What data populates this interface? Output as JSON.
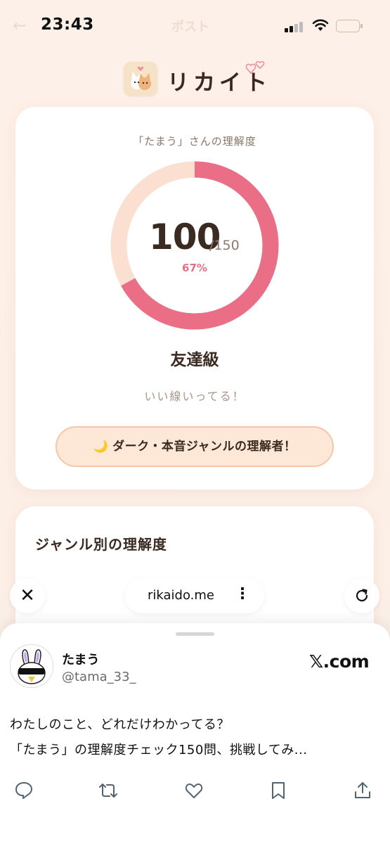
{
  "status": {
    "time": "23:43"
  },
  "ghost_header": {
    "back": "←",
    "title": "ポスト"
  },
  "app": {
    "name": "リカイト"
  },
  "result": {
    "caption": "「たまう」さんの理解度",
    "score": "100",
    "total": "/150",
    "percent_label": "67%",
    "progress": 0.67,
    "rank": "友達級",
    "comment": "いい線いってる！",
    "badge_icon": "🌙",
    "badge_label": "ダーク・本音ジャンルの理解者！"
  },
  "genre": {
    "title": "ジャンル別の理解度"
  },
  "browser": {
    "close": "✕",
    "url": "rikaido.me",
    "more": "⋮"
  },
  "tweet": {
    "name": "たまう",
    "handle": "@tama_33_",
    "source": "𝕏.com",
    "line1": "わたしのこと、どれだけわかってる？",
    "line2": "「たまう」の理解度チェック150問、挑戦してみ..."
  },
  "colors": {
    "ring_fill": "#ea6f86",
    "ring_track": "#fbe0d2",
    "badge_bg": "#fde8d8",
    "badge_border": "#f5c6a8",
    "battery": "#f4c53e"
  },
  "icons": [
    "back-arrow-icon",
    "signal-icon",
    "wifi-icon",
    "battery-icon",
    "cat-logo-icon",
    "hearts-icon",
    "moon-icon",
    "close-icon",
    "more-vertical-icon",
    "reload-icon",
    "reply-icon",
    "repost-icon",
    "like-icon",
    "bookmark-icon",
    "share-icon"
  ]
}
